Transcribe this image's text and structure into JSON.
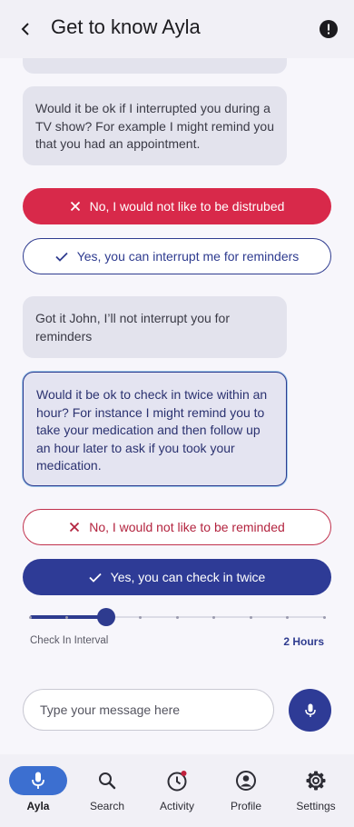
{
  "header": {
    "title": "Get to know Ayla"
  },
  "messages": [
    {
      "text": ""
    },
    {
      "text": "Would it be ok if I interrupted you during a TV show? For example I might remind you that you had an appointment."
    },
    {
      "text": "Got it John, I’ll not interrupt you for reminders"
    },
    {
      "text": "Would it be ok to check in twice within an hour? For instance I might remind you to take your medication and then follow up an hour later to ask if you took your medication."
    }
  ],
  "responses": {
    "q1_no": "No, I would not like to be distrubed",
    "q1_yes": "Yes, you can interrupt me for reminders",
    "q2_no": "No, I would not like to be reminded",
    "q2_yes": "Yes, you can check in twice"
  },
  "slider": {
    "label": "Check In Interval",
    "value_text": "2 Hours",
    "level": 0.26,
    "ticks": 9
  },
  "composer": {
    "placeholder": "Type your message here"
  },
  "nav": {
    "items": [
      {
        "label": "Ayla",
        "icon": "mic-icon"
      },
      {
        "label": "Search",
        "icon": "search-icon"
      },
      {
        "label": "Activity",
        "icon": "clock-icon"
      },
      {
        "label": "Profile",
        "icon": "account-icon"
      },
      {
        "label": "Settings",
        "icon": "gear-icon"
      }
    ],
    "active": "Ayla"
  },
  "colors": {
    "primary": "#2e3b8f",
    "danger": "#d8294a",
    "active_nav": "#3c6fd0",
    "notification_dot": "#c0203c"
  }
}
